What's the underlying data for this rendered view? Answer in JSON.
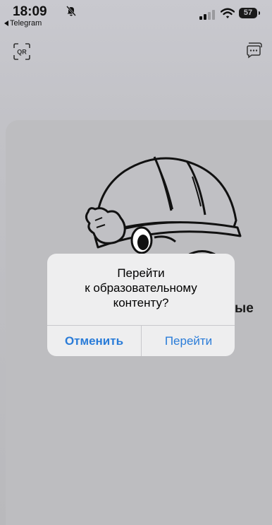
{
  "status_bar": {
    "time": "18:09",
    "back_app": "Telegram",
    "battery": "57"
  },
  "background": {
    "partial_text": "ые"
  },
  "alert": {
    "title": "Перейти\nк образовательному\nконтенту?",
    "cancel_label": "Отменить",
    "confirm_label": "Перейти",
    "accent_color": "#2a7cd8"
  }
}
